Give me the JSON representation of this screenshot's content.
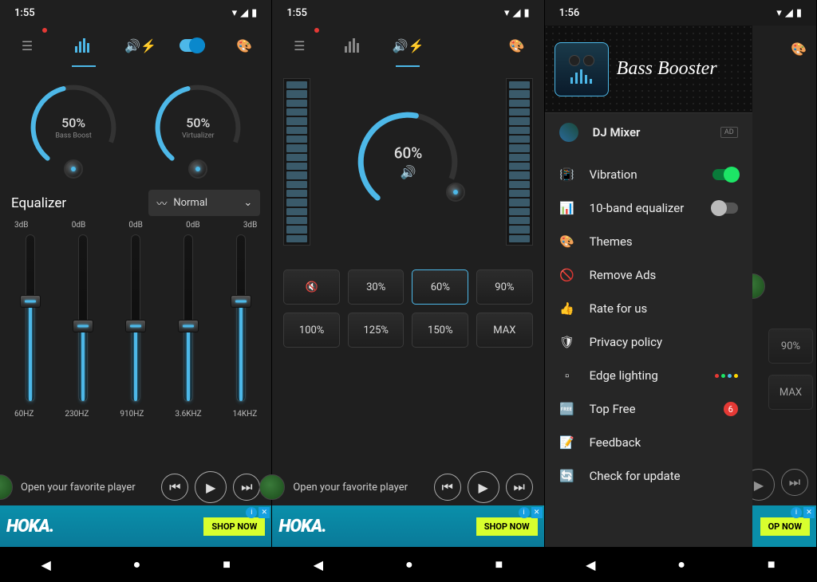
{
  "screen1": {
    "time": "1:55",
    "bass_pct": "50%",
    "bass_lbl": "Bass Boost",
    "virt_pct": "50%",
    "virt_lbl": "Virtualizer",
    "eq_title": "Equalizer",
    "preset": "Normal",
    "db": [
      "3dB",
      "0dB",
      "0dB",
      "0dB",
      "3dB"
    ],
    "hz": [
      "60HZ",
      "230HZ",
      "910HZ",
      "3.6KHZ",
      "14KHZ"
    ],
    "slider_fill_pct": [
      60,
      45,
      45,
      45,
      60
    ],
    "player_text": "Open your favorite player",
    "ad_brand": "HOKA.",
    "ad_cta": "SHOP NOW"
  },
  "screen2": {
    "time": "1:55",
    "vol_pct": "60%",
    "buttons": [
      "30%",
      "60%",
      "90%",
      "100%",
      "125%",
      "150%",
      "MAX"
    ],
    "active_btn": "60%",
    "player_text": "Open your favorite player",
    "ad_brand": "HOKA.",
    "ad_cta": "SHOP NOW"
  },
  "screen3": {
    "time": "1:56",
    "app_title": "Bass Booster",
    "featured": "DJ Mixer",
    "featured_tag": "AD",
    "items": [
      {
        "icon": "📳",
        "label": "Vibration",
        "kind": "switch-on"
      },
      {
        "icon": "📊",
        "label": "10-band equalizer",
        "kind": "switch-off"
      },
      {
        "icon": "🎨",
        "label": "Themes"
      },
      {
        "icon": "🚫",
        "label": "Remove Ads"
      },
      {
        "icon": "👍",
        "label": "Rate for us"
      },
      {
        "icon": "🛡",
        "label": "Privacy policy"
      },
      {
        "icon": "▫",
        "label": "Edge lighting",
        "kind": "dots"
      },
      {
        "icon": "🆓",
        "label": "Top Free",
        "kind": "badge",
        "badge": "6"
      },
      {
        "icon": "📝",
        "label": "Feedback"
      },
      {
        "icon": "🔄",
        "label": "Check for update"
      }
    ],
    "behind_btns": [
      "90%",
      "MAX"
    ],
    "ad_cta": "OP NOW"
  }
}
